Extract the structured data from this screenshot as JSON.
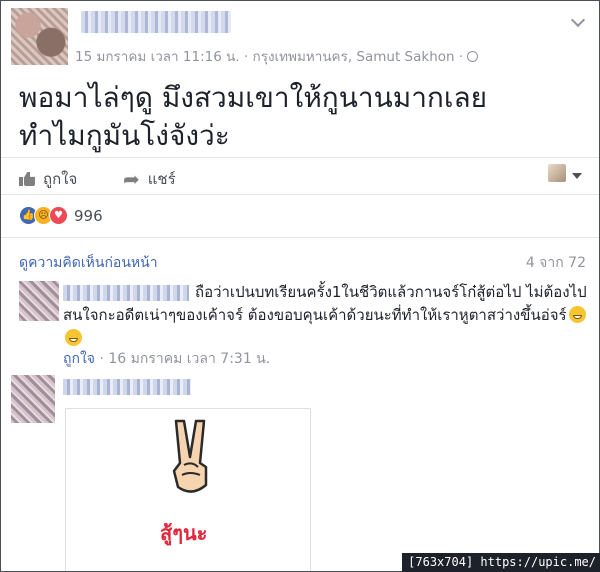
{
  "post": {
    "meta": "15 มกราคม เวลา 11:16 น. · กรุงเทพมหานคร, Samut Sakhon ·",
    "text_line1": "พอมาไล่ๆดู มึงสวมเขาให้กูนานมากเลย",
    "text_line2": "ทำไมกูมันโง่จังว่ะ"
  },
  "actions": {
    "like_label": "ถูกใจ",
    "share_label": "แชร์"
  },
  "reactions": {
    "count": "996",
    "types": [
      "like-icon",
      "sad-icon",
      "love-icon"
    ]
  },
  "comments_header": {
    "previous_link": "ดูความคิดเห็นก่อนหน้า",
    "count": "4 จาก 72"
  },
  "comment1": {
    "text": "ถือว่าเปนบทเรียนครั้ง1ในชีวิตแล้วกานจร์โก๋สู้ต่อไป ไม่ต้องไปสนใจกะอดีตเน่าๆของเค้าจร์ ต้องขอบคุนเค้าด้วยนะที่ทำให้เราหูตาสว่างขึ้นอ่จร์",
    "like_label": "ถูกใจ",
    "timestamp": "16 มกราคม เวลา 7:31 น."
  },
  "comment2": {
    "sticker_text": "สู้ๆนะ"
  },
  "watermark": "[763x704] https://upic.me/",
  "colors": {
    "link": "#4267b2",
    "meta": "#90949c",
    "text": "#1d2129",
    "love": "#ed4956",
    "like": "#4267b2"
  }
}
